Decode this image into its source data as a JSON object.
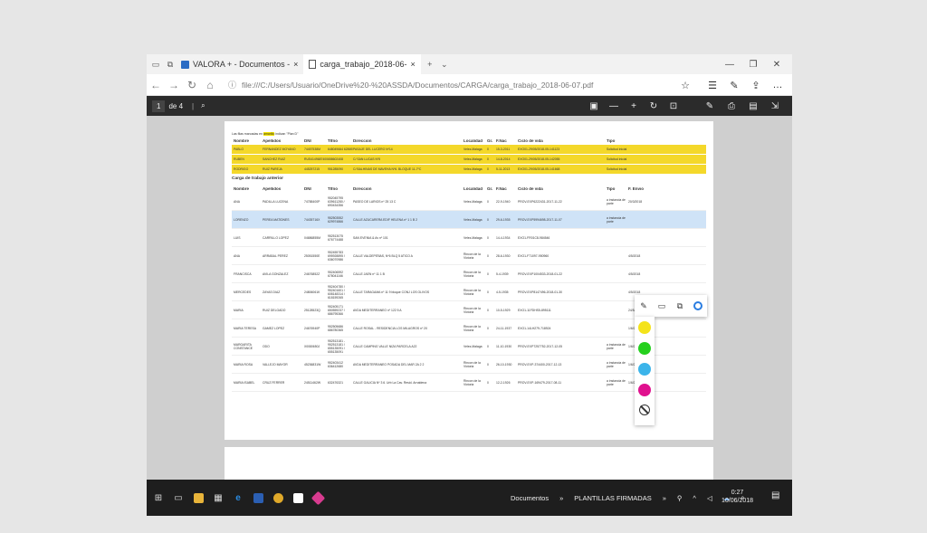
{
  "tabs": [
    {
      "label": "VALORA + - Documentos -"
    },
    {
      "label": "carga_trabajo_2018-06-"
    }
  ],
  "address": {
    "url": "file:///C:/Users/Usuario/OneDrive%20-%20ASSDA/Documentos/CARGA/carga_trabajo_2018-06-07.pdf"
  },
  "pdf": {
    "page_num": "1",
    "page_total": "de 4"
  },
  "doc": {
    "note_prefix": "Las filas marcadas en ",
    "note_highlight": "amarillo",
    "note_suffix": " indican \"Plan D\"",
    "headers": {
      "nombre": "Nombre",
      "apellidos": "Apellidos",
      "dni": "DNI",
      "tlfno": "Tlfno",
      "direccion": "Direccion",
      "localidad": "Localidad",
      "gr": "Gr.",
      "fnac": "F.Nac",
      "ciclo": "Ciclo de vida",
      "tipo": "Tipo",
      "fenvio": "F. Envio"
    },
    "plan_rows": [
      {
        "nombre": "PABLO",
        "apellidos": "FERNANDEZ MOYANO",
        "dni": "74457538M",
        "tlfno": "648049664 628693490",
        "direccion": "PASAJE DEL LUCERO Nº14",
        "localidad": "Velez-Malaga",
        "gr": "0",
        "fnac": "15-3-2011",
        "ciclo": "EXO01-29/05/2018-05-141123",
        "tipo": "Solicitud inicial"
      },
      {
        "nombre": "RUBEN",
        "apellidos": "SANCHEZ RUIZ",
        "dni": "RUS41496874000055",
        "tlfno": "658602408",
        "direccion": "C/ SAN LUCAS Nº5",
        "localidad": "Velez-Malaga",
        "gr": "0",
        "fnac": "14-8-2014",
        "ciclo": "EXO01-29/05/2018-05-142055",
        "tipo": "Solicitud inicial"
      },
      {
        "nombre": "RODRIGO",
        "apellidos": "RUIZ PAREJA",
        "dni": "445257215",
        "tlfno": "951285090",
        "direccion": "C/ BALHINAS DE MAVEHA Nº6. BLOQUE 11-7ºC",
        "localidad": "Velez-Malaga",
        "gr": "0",
        "fnac": "5-11-2013",
        "ciclo": "EXO01-29/05/2018-05-141668",
        "tipo": "Solicitud inicial"
      }
    ],
    "section_title": "Carga de trabajo anterior",
    "rows": [
      {
        "nombre": "ANA",
        "apellidos": "PADILLA LUCENA",
        "dni": "74788400P",
        "tlfno": "952045795 639611280 / 690434356",
        "direccion": "PASEO DE LARIOS nº 25 13 C",
        "localidad": "Velez-Malaga",
        "gr": "0",
        "fnac": "22-9-1940",
        "ciclo": "PROV-EXP6222431-2017-11-22",
        "tipo": "a instancia de parte",
        "fenvio": "20/3/2018"
      },
      {
        "nombre": "LORENZO",
        "apellidos": "PEREA MATIDNES",
        "dni": "74435716X",
        "tlfno": "952503552 629974866",
        "direccion": "CALLE AZUCARERA EDIF HELENA nº 1 1 B 2",
        "localidad": "Velez-Malaga",
        "gr": "0",
        "fnac": "29-6-1935",
        "ciclo": "PROV-EXP5994698-2017-11-07",
        "tipo": "a instancia de parte",
        "fenvio": ""
      },
      {
        "nombre": "LUIS",
        "apellidos": "CARRILLO LOPEZ",
        "dni": "04686855M",
        "tlfno": "952513075 676774488",
        "direccion": "SAN EVENIA & Av nº 101",
        "localidad": "Velez-Malaga",
        "gr": "0",
        "fnac": "14-4-1934",
        "ciclo": "EXO1-FR01C8-984546",
        "tipo": "",
        "fenvio": ""
      },
      {
        "nombre": "ANA",
        "apellidos": "ARRABAL PEREZ",
        "dni": "25051550E",
        "tlfno": "952455783 695928895 / 636070986",
        "direccion": "CALLE VALDEPEÑAS, Nº6 BLQ 5 ATICO A",
        "localidad": "Rincon de la Victoria",
        "gr": "0",
        "fnac": "28-6-1930",
        "ciclo": "EXO1-F71097-950960",
        "tipo": "",
        "fenvio": "4/5/2018"
      },
      {
        "nombre": "FRANCISCA",
        "apellidos": "AVILA GONZALEZ",
        "dni": "24676852Z",
        "tlfno": "952406592 678041166",
        "direccion": "CALLE JAEN nº 11 1 B",
        "localidad": "Rincon de la Victoria",
        "gr": "0",
        "fnac": "5-4-1939",
        "ciclo": "PROV-EXP1004533-2018-01-22",
        "tipo": "",
        "fenvio": "4/5/2018"
      },
      {
        "nombre": "MERCEDES",
        "apellidos": "ZAYAS DIAZ",
        "dni": "24806061K",
        "tlfno": "952404780 / 952401601 / 608148314 / 618159265",
        "direccion": "CALLE TARAGAMA nº 11 9 bloque CONJ LOS OLIVOS",
        "localidad": "Rincon de la Victoria",
        "gr": "0",
        "fnac": "4-5-1935",
        "ciclo": "PROV-EXP8147496-2018-01-30",
        "tipo": "",
        "fenvio": "4/5/2018"
      },
      {
        "nombre": "MARIA",
        "apellidos": "RUIZ DELGADO",
        "dni": "25128523Q",
        "tlfno": "952405171 650559237 / 686795366",
        "direccion": "AVDA MEDITERRANEO nº 122 5 A",
        "localidad": "Rincon de la Victoria",
        "gr": "0",
        "fnac": "10-5-1929",
        "ciclo": "EXO1-11FDHS5-895111",
        "tipo": "",
        "fenvio": "24/5/2018"
      },
      {
        "nombre": "MARIA TERESA",
        "apellidos": "GAMEZ LOPEZ",
        "dni": "24676940P",
        "tlfno": "952505686 686780365",
        "direccion": "CALLE ROSAL - RESIDENCIA LOS MILAGROS nº 20",
        "localidad": "Rincon de la Victoria",
        "gr": "0",
        "fnac": "24-11-1937",
        "ciclo": "EXO1-14LH279-718924",
        "tipo": "",
        "fenvio": "1/6/2018"
      },
      {
        "nombre": "MARGARITA CONSTANCE",
        "apellidos": "ODO",
        "dni": "X0080650J",
        "tlfno": "952513181 - 952513181 / 655135091 / 655135091",
        "direccion": "CALLE CAMPING VALLE NIZA PARCELA A22",
        "localidad": "Velez-Malaga",
        "gr": "0",
        "fnac": "11-10-1930",
        "ciclo": "PROV-EXP7257752-2017-12-05",
        "tipo": "a instancia de parte",
        "fenvio": "1/6/2018"
      },
      {
        "nombre": "MARIA ROSA",
        "apellidos": "VALLEJO MAYOR",
        "dni": "45236831W",
        "tlfno": "952403412 636412680",
        "direccion": "AVDA MEDITERRANEO POSADA DEL MAR 2A 2 2",
        "localidad": "Rincon de la Victoria",
        "gr": "0",
        "fnac": "26-10-1930",
        "ciclo": "PROV-EXP-374400-2017-12-13",
        "tipo": "a instancia de parte",
        "fenvio": "1/6/2018"
      },
      {
        "nombre": "MARIA ISABEL",
        "apellidos": "CRUZ FERRER",
        "dni": "24511462W",
        "tlfno": "632476321",
        "direccion": "CALLE GALICIA Nº 3 6. Urb La Cav. Resid. Arrutdena",
        "localidad": "Rincon de la Victoria",
        "gr": "0",
        "fnac": "12-2-1926",
        "ciclo": "PROV-EXP-169479-2017-08-11",
        "tipo": "a instancia de parte",
        "fenvio": "1/6/2018"
      }
    ]
  },
  "colors": {
    "yellow": "#f4e31a",
    "green": "#25d01e",
    "blue": "#3bb4ea",
    "magenta": "#e0118e",
    "accent": "#2a7de1"
  },
  "icons": [
    "highlighter-icon",
    "comment-icon",
    "copy-icon",
    "cortana-icon",
    "no-color-icon"
  ],
  "taskbar": {
    "folder": "Documentos",
    "sep": "»",
    "folder2": "PLANTILLAS FIRMADAS",
    "sep2": "»",
    "time": "0:27",
    "date": "10/06/2018"
  }
}
